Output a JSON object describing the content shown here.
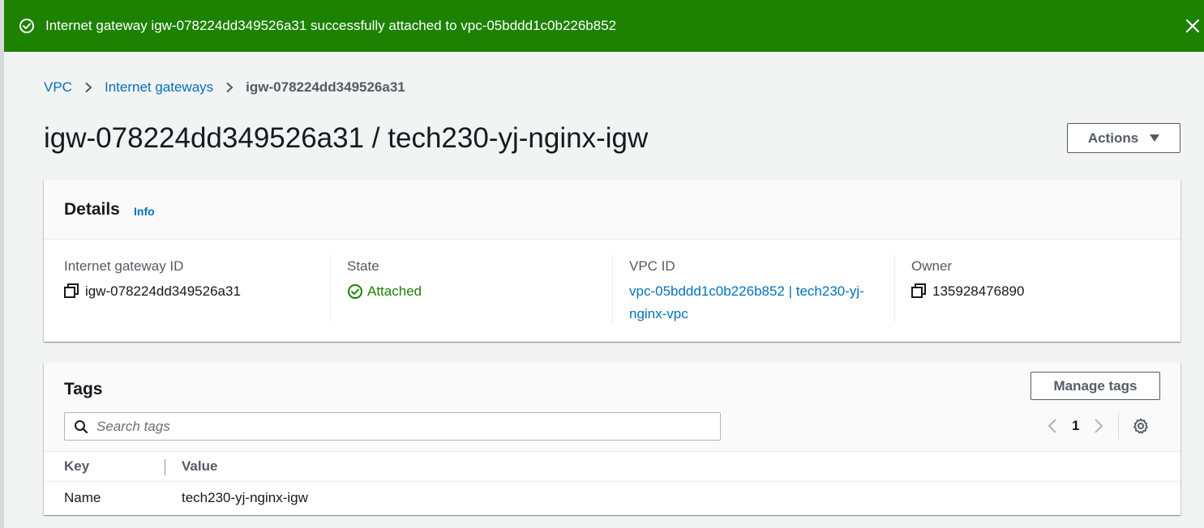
{
  "flash": {
    "message": "Internet gateway igw-078224dd349526a31 successfully attached to vpc-05bddd1c0b226b852",
    "color": "#1d8102"
  },
  "breadcrumb": {
    "items": [
      "VPC",
      "Internet gateways"
    ],
    "current": "igw-078224dd349526a31"
  },
  "page": {
    "title": "igw-078224dd349526a31 / tech230-yj-nginx-igw",
    "actions_label": "Actions"
  },
  "details": {
    "title": "Details",
    "info_label": "Info",
    "fields": [
      {
        "label": "Internet gateway ID",
        "value": "igw-078224dd349526a31"
      },
      {
        "label": "State",
        "value": "Attached"
      },
      {
        "label": "VPC ID",
        "value": "vpc-05bddd1c0b226b852 | tech230-yj-nginx-vpc"
      },
      {
        "label": "Owner",
        "value": "135928476890"
      }
    ]
  },
  "tags": {
    "title": "Tags",
    "manage_label": "Manage tags",
    "search_placeholder": "Search tags",
    "page_number": "1",
    "columns": [
      "Key",
      "Value"
    ],
    "rows": [
      {
        "key": "Name",
        "value": "tech230-yj-nginx-igw"
      }
    ]
  },
  "colors": {
    "link": "#0073bb",
    "success": "#1d8102"
  }
}
